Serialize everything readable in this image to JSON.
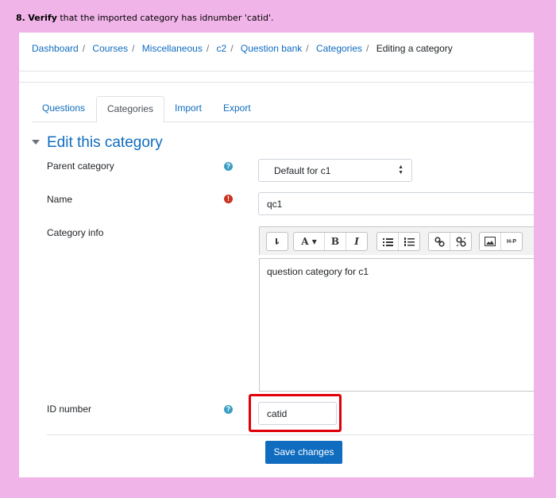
{
  "instruction": {
    "step": "8.",
    "bold": "Verify",
    "rest": " that the imported category has idnumber 'catid'."
  },
  "breadcrumb": [
    "Dashboard",
    "Courses",
    "Miscellaneous",
    "c2",
    "Question bank",
    "Categories",
    "Editing a category"
  ],
  "tabs": [
    "Questions",
    "Categories",
    "Import",
    "Export"
  ],
  "active_tab": "Categories",
  "section_title": "Edit this category",
  "form": {
    "parent_label": "Parent category",
    "parent_value": "Default for c1",
    "name_label": "Name",
    "name_value": "qc1",
    "info_label": "Category info",
    "info_value": "question category for c1",
    "id_label": "ID number",
    "id_value": "catid",
    "save_label": "Save changes"
  },
  "colors": {
    "link": "#0f6cbf",
    "highlight": "#e0000a",
    "background": "#f1b4e8"
  }
}
